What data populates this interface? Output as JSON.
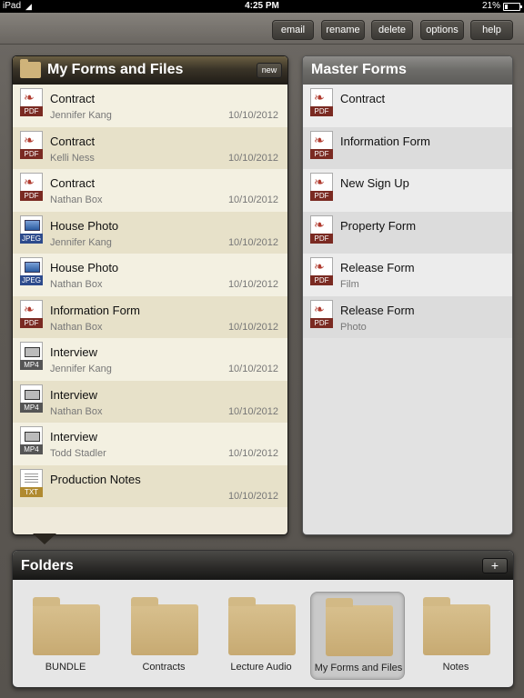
{
  "status_bar": {
    "carrier": "iPad",
    "time": "4:25 PM",
    "battery": "21%"
  },
  "toolbar": {
    "buttons": [
      {
        "label": "email"
      },
      {
        "label": "rename"
      },
      {
        "label": "delete"
      },
      {
        "label": "options"
      },
      {
        "label": "help"
      }
    ]
  },
  "my_forms": {
    "title": "My Forms and Files",
    "new_label": "new",
    "rows": [
      {
        "name": "Contract",
        "owner": "Jennifer Kang",
        "date": "10/10/2012",
        "type": "PDF"
      },
      {
        "name": "Contract",
        "owner": "Kelli Ness",
        "date": "10/10/2012",
        "type": "PDF"
      },
      {
        "name": "Contract",
        "owner": "Nathan Box",
        "date": "10/10/2012",
        "type": "PDF"
      },
      {
        "name": "House Photo",
        "owner": "Jennifer Kang",
        "date": "10/10/2012",
        "type": "JPEG"
      },
      {
        "name": "House Photo",
        "owner": "Nathan Box",
        "date": "10/10/2012",
        "type": "JPEG"
      },
      {
        "name": "Information Form",
        "owner": "Nathan Box",
        "date": "10/10/2012",
        "type": "PDF"
      },
      {
        "name": "Interview",
        "owner": "Jennifer Kang",
        "date": "10/10/2012",
        "type": "MP4"
      },
      {
        "name": "Interview",
        "owner": "Nathan Box",
        "date": "10/10/2012",
        "type": "MP4"
      },
      {
        "name": "Interview",
        "owner": "Todd Stadler",
        "date": "10/10/2012",
        "type": "MP4"
      },
      {
        "name": "Production Notes",
        "owner": "",
        "date": "10/10/2012",
        "type": "TXT"
      }
    ]
  },
  "master_forms": {
    "title": "Master Forms",
    "rows": [
      {
        "name": "Contract",
        "sub": "",
        "type": "PDF"
      },
      {
        "name": "Information Form",
        "sub": "",
        "type": "PDF"
      },
      {
        "name": "New Sign Up",
        "sub": "",
        "type": "PDF"
      },
      {
        "name": "Property Form",
        "sub": "",
        "type": "PDF"
      },
      {
        "name": "Release Form",
        "sub": "Film",
        "type": "PDF"
      },
      {
        "name": "Release Form",
        "sub": "Photo",
        "type": "PDF"
      }
    ]
  },
  "folders": {
    "title": "Folders",
    "add_label": "+",
    "items": [
      {
        "label": "BUNDLE",
        "selected": false
      },
      {
        "label": "Contracts",
        "selected": false
      },
      {
        "label": "Lecture Audio",
        "selected": false
      },
      {
        "label": "My Forms and Files",
        "selected": true
      },
      {
        "label": "Notes",
        "selected": false
      }
    ]
  }
}
